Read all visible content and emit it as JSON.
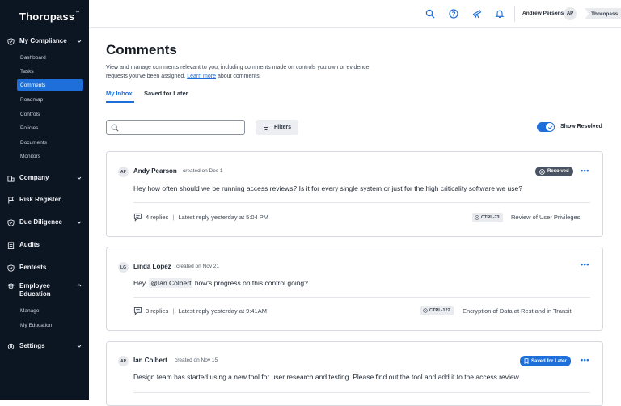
{
  "app": {
    "logo": "Thoropass",
    "logo_tm": "™"
  },
  "sidebar": {
    "sections": [
      {
        "label": "My Compliance",
        "icon": "shield-check-icon"
      },
      {
        "label": "Company",
        "icon": "building-icon"
      },
      {
        "label": "Risk Register",
        "icon": "flag-icon"
      },
      {
        "label": "Due Diligence",
        "icon": "shield-check-icon"
      },
      {
        "label": "Audits",
        "icon": "clipboard-icon"
      },
      {
        "label": "Pentests",
        "icon": "shield-check-icon"
      },
      {
        "label": "Employee Education",
        "icon": "graduation-cap-icon"
      },
      {
        "label": "Settings",
        "icon": "gear-icon"
      }
    ],
    "compliance_items": [
      "Dashboard",
      "Tasks",
      "Comments",
      "Roadmap",
      "Controls",
      "Policies",
      "Documents",
      "Monitors"
    ],
    "education_items": [
      "Manage",
      "My Education"
    ]
  },
  "topbar": {
    "user_name": "Andrew Persons",
    "user_initials": "AP",
    "org": "Thoropass"
  },
  "page": {
    "title": "Comments",
    "desc_1": "View and manage comments relevant to you, including comments made on controls you own or evidence",
    "desc_2": "requests you've been assigned.",
    "desc_link": "Learn more",
    "desc_3": "about comments.",
    "tabs": [
      "My Inbox",
      "Saved for Later"
    ],
    "search_placeholder": "",
    "filters_label": "Filters",
    "toggle_label": "Show Resolved"
  },
  "comments": [
    {
      "initials": "AP",
      "author": "Andy Pearson",
      "date": "created on Dec 1",
      "status": "Resolved",
      "body": "Hey how often should we be running access reviews? Is it for every single system or just for the high criticality software we use?",
      "replies": "4 replies",
      "latest": "Latest reply yesterday at 5:04 PM",
      "control_id": "CTRL-73",
      "control_name": "Review of User Privileges"
    },
    {
      "initials": "LG",
      "author": "Linda Lopez",
      "date": "created on Nov 21",
      "body_pre": "Hey,",
      "mention": "@Ian Colbert",
      "body_post": "how's progress on this control going?",
      "replies": "3 replies",
      "latest": "Latest reply yesterday at 9:41AM",
      "control_id": "CTRL-122",
      "control_name": "Encryption of Data at Rest and in Transit"
    },
    {
      "initials": "AP",
      "author": "Ian Colbert",
      "date": "created on Nov 15",
      "status": "Saved for Later",
      "body": "Design team has started using a new tool for user research and testing. Please find out the tool and add it to the access review..."
    }
  ],
  "more_label": "•••",
  "colors": {
    "sidebar_bg": "#0c1522",
    "accent": "#1e6fd9",
    "resolved_badge": "#4a5361"
  }
}
